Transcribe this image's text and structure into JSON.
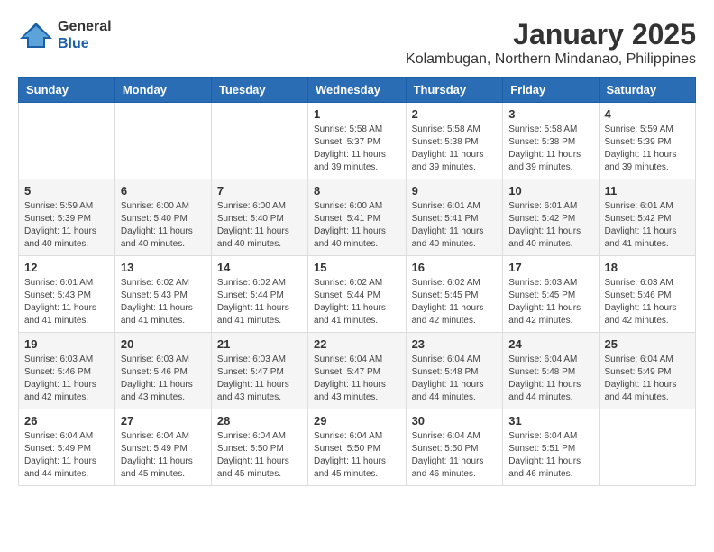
{
  "logo": {
    "general": "General",
    "blue": "Blue"
  },
  "title": "January 2025",
  "subtitle": "Kolambugan, Northern Mindanao, Philippines",
  "days_of_week": [
    "Sunday",
    "Monday",
    "Tuesday",
    "Wednesday",
    "Thursday",
    "Friday",
    "Saturday"
  ],
  "weeks": [
    [
      {
        "day": "",
        "sunrise": "",
        "sunset": "",
        "daylight": ""
      },
      {
        "day": "",
        "sunrise": "",
        "sunset": "",
        "daylight": ""
      },
      {
        "day": "",
        "sunrise": "",
        "sunset": "",
        "daylight": ""
      },
      {
        "day": "1",
        "sunrise": "Sunrise: 5:58 AM",
        "sunset": "Sunset: 5:37 PM",
        "daylight": "Daylight: 11 hours and 39 minutes."
      },
      {
        "day": "2",
        "sunrise": "Sunrise: 5:58 AM",
        "sunset": "Sunset: 5:38 PM",
        "daylight": "Daylight: 11 hours and 39 minutes."
      },
      {
        "day": "3",
        "sunrise": "Sunrise: 5:58 AM",
        "sunset": "Sunset: 5:38 PM",
        "daylight": "Daylight: 11 hours and 39 minutes."
      },
      {
        "day": "4",
        "sunrise": "Sunrise: 5:59 AM",
        "sunset": "Sunset: 5:39 PM",
        "daylight": "Daylight: 11 hours and 39 minutes."
      }
    ],
    [
      {
        "day": "5",
        "sunrise": "Sunrise: 5:59 AM",
        "sunset": "Sunset: 5:39 PM",
        "daylight": "Daylight: 11 hours and 40 minutes."
      },
      {
        "day": "6",
        "sunrise": "Sunrise: 6:00 AM",
        "sunset": "Sunset: 5:40 PM",
        "daylight": "Daylight: 11 hours and 40 minutes."
      },
      {
        "day": "7",
        "sunrise": "Sunrise: 6:00 AM",
        "sunset": "Sunset: 5:40 PM",
        "daylight": "Daylight: 11 hours and 40 minutes."
      },
      {
        "day": "8",
        "sunrise": "Sunrise: 6:00 AM",
        "sunset": "Sunset: 5:41 PM",
        "daylight": "Daylight: 11 hours and 40 minutes."
      },
      {
        "day": "9",
        "sunrise": "Sunrise: 6:01 AM",
        "sunset": "Sunset: 5:41 PM",
        "daylight": "Daylight: 11 hours and 40 minutes."
      },
      {
        "day": "10",
        "sunrise": "Sunrise: 6:01 AM",
        "sunset": "Sunset: 5:42 PM",
        "daylight": "Daylight: 11 hours and 40 minutes."
      },
      {
        "day": "11",
        "sunrise": "Sunrise: 6:01 AM",
        "sunset": "Sunset: 5:42 PM",
        "daylight": "Daylight: 11 hours and 41 minutes."
      }
    ],
    [
      {
        "day": "12",
        "sunrise": "Sunrise: 6:01 AM",
        "sunset": "Sunset: 5:43 PM",
        "daylight": "Daylight: 11 hours and 41 minutes."
      },
      {
        "day": "13",
        "sunrise": "Sunrise: 6:02 AM",
        "sunset": "Sunset: 5:43 PM",
        "daylight": "Daylight: 11 hours and 41 minutes."
      },
      {
        "day": "14",
        "sunrise": "Sunrise: 6:02 AM",
        "sunset": "Sunset: 5:44 PM",
        "daylight": "Daylight: 11 hours and 41 minutes."
      },
      {
        "day": "15",
        "sunrise": "Sunrise: 6:02 AM",
        "sunset": "Sunset: 5:44 PM",
        "daylight": "Daylight: 11 hours and 41 minutes."
      },
      {
        "day": "16",
        "sunrise": "Sunrise: 6:02 AM",
        "sunset": "Sunset: 5:45 PM",
        "daylight": "Daylight: 11 hours and 42 minutes."
      },
      {
        "day": "17",
        "sunrise": "Sunrise: 6:03 AM",
        "sunset": "Sunset: 5:45 PM",
        "daylight": "Daylight: 11 hours and 42 minutes."
      },
      {
        "day": "18",
        "sunrise": "Sunrise: 6:03 AM",
        "sunset": "Sunset: 5:46 PM",
        "daylight": "Daylight: 11 hours and 42 minutes."
      }
    ],
    [
      {
        "day": "19",
        "sunrise": "Sunrise: 6:03 AM",
        "sunset": "Sunset: 5:46 PM",
        "daylight": "Daylight: 11 hours and 42 minutes."
      },
      {
        "day": "20",
        "sunrise": "Sunrise: 6:03 AM",
        "sunset": "Sunset: 5:46 PM",
        "daylight": "Daylight: 11 hours and 43 minutes."
      },
      {
        "day": "21",
        "sunrise": "Sunrise: 6:03 AM",
        "sunset": "Sunset: 5:47 PM",
        "daylight": "Daylight: 11 hours and 43 minutes."
      },
      {
        "day": "22",
        "sunrise": "Sunrise: 6:04 AM",
        "sunset": "Sunset: 5:47 PM",
        "daylight": "Daylight: 11 hours and 43 minutes."
      },
      {
        "day": "23",
        "sunrise": "Sunrise: 6:04 AM",
        "sunset": "Sunset: 5:48 PM",
        "daylight": "Daylight: 11 hours and 44 minutes."
      },
      {
        "day": "24",
        "sunrise": "Sunrise: 6:04 AM",
        "sunset": "Sunset: 5:48 PM",
        "daylight": "Daylight: 11 hours and 44 minutes."
      },
      {
        "day": "25",
        "sunrise": "Sunrise: 6:04 AM",
        "sunset": "Sunset: 5:49 PM",
        "daylight": "Daylight: 11 hours and 44 minutes."
      }
    ],
    [
      {
        "day": "26",
        "sunrise": "Sunrise: 6:04 AM",
        "sunset": "Sunset: 5:49 PM",
        "daylight": "Daylight: 11 hours and 44 minutes."
      },
      {
        "day": "27",
        "sunrise": "Sunrise: 6:04 AM",
        "sunset": "Sunset: 5:49 PM",
        "daylight": "Daylight: 11 hours and 45 minutes."
      },
      {
        "day": "28",
        "sunrise": "Sunrise: 6:04 AM",
        "sunset": "Sunset: 5:50 PM",
        "daylight": "Daylight: 11 hours and 45 minutes."
      },
      {
        "day": "29",
        "sunrise": "Sunrise: 6:04 AM",
        "sunset": "Sunset: 5:50 PM",
        "daylight": "Daylight: 11 hours and 45 minutes."
      },
      {
        "day": "30",
        "sunrise": "Sunrise: 6:04 AM",
        "sunset": "Sunset: 5:50 PM",
        "daylight": "Daylight: 11 hours and 46 minutes."
      },
      {
        "day": "31",
        "sunrise": "Sunrise: 6:04 AM",
        "sunset": "Sunset: 5:51 PM",
        "daylight": "Daylight: 11 hours and 46 minutes."
      },
      {
        "day": "",
        "sunrise": "",
        "sunset": "",
        "daylight": ""
      }
    ]
  ]
}
